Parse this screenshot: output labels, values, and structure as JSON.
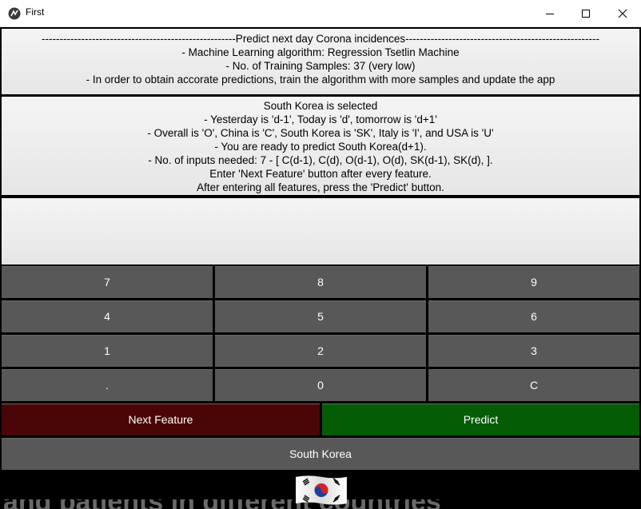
{
  "window": {
    "title": "First",
    "icons": [
      "app-icon",
      "minimize-icon",
      "maximize-icon",
      "close-icon"
    ]
  },
  "info_panel": {
    "lines": [
      "------------------------------------------------------Predict next day Corona incidences------------------------------------------------------",
      "- Machine Learning algorithm: Regression Tsetlin Machine",
      "- No. of Training Samples: 37 (very low)",
      "- In order to obtain accorate predictions, train the algorithm with more samples and update the app"
    ]
  },
  "status_panel": {
    "lines": [
      "South Korea is selected",
      "- Yesterday is 'd-1', Today is 'd', tomorrow is 'd+1'",
      "- Overall is 'O', China is 'C', South Korea is 'SK', Italy is 'I', and USA is 'U'",
      "- You are ready to predict South Korea(d+1).",
      "- No. of inputs needed: 7 - [ C(d-1), C(d), O(d-1), O(d), SK(d-1), SK(d),  ].",
      "Enter 'Next Feature' button after every feature.",
      "After entering all features, press the 'Predict' button."
    ]
  },
  "input_display": {
    "value": ""
  },
  "keypad": {
    "rows": [
      [
        "7",
        "8",
        "9"
      ],
      [
        "4",
        "5",
        "6"
      ],
      [
        "1",
        "2",
        "3"
      ],
      [
        ".",
        "0",
        "C"
      ]
    ]
  },
  "actions": {
    "next_feature": "Next Feature",
    "predict": "Predict",
    "country": "South Korea"
  },
  "colors": {
    "key_bg": "#585858",
    "next_bg": "#4a0606",
    "predict_bg": "#045c04",
    "panel_bg": "#eeeeee"
  },
  "background_text": "and patients in different countries"
}
